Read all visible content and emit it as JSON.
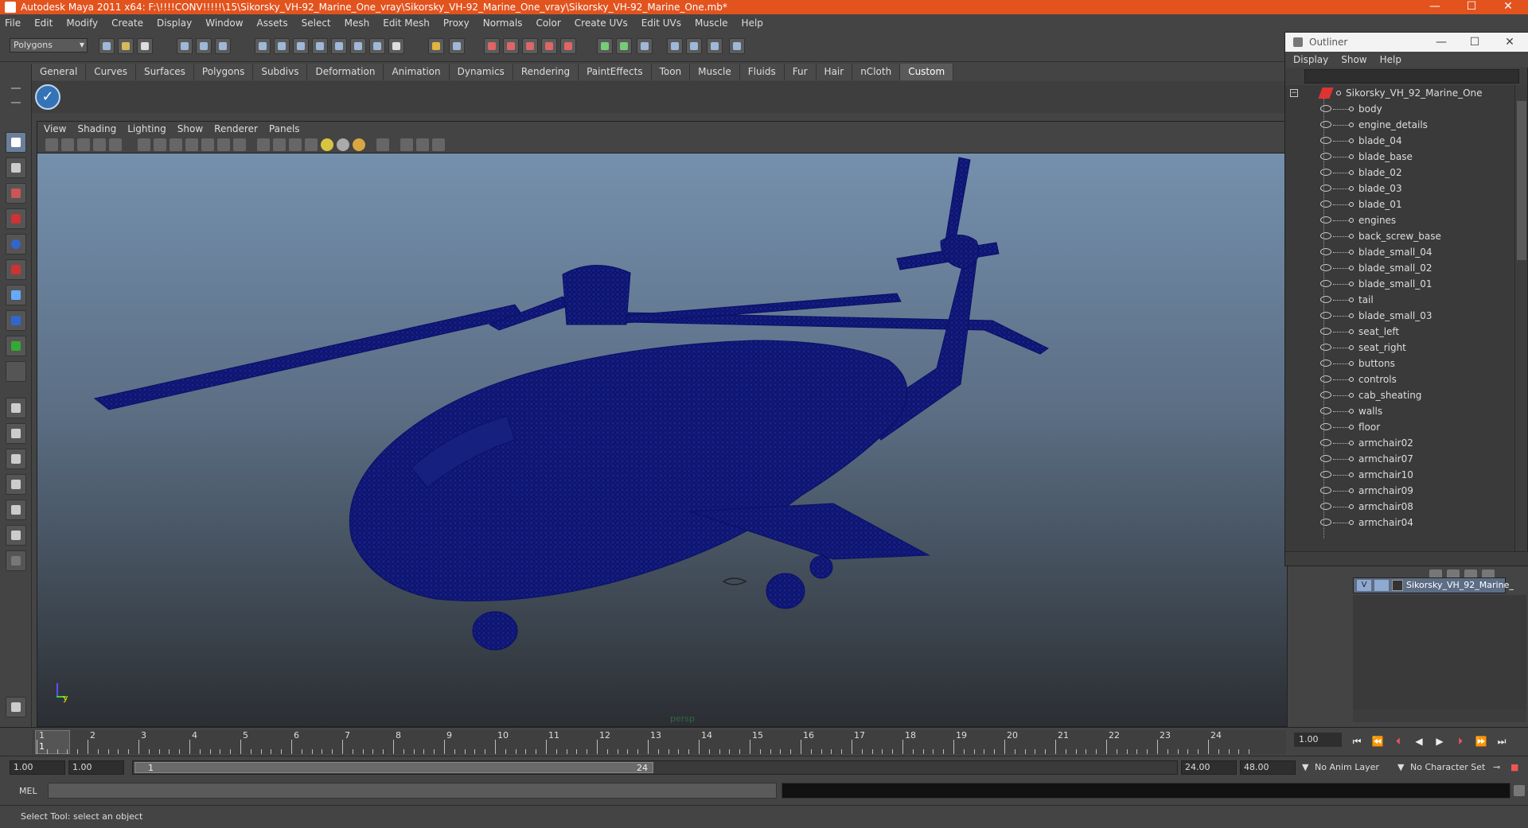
{
  "window": {
    "title": "Autodesk Maya 2011 x64: F:\\!!!!CONV!!!!!\\15\\Sikorsky_VH-92_Marine_One_vray\\Sikorsky_VH-92_Marine_One_vray\\Sikorsky_VH-92_Marine_One.mb*",
    "minimize": "—",
    "maximize": "☐",
    "close": "✕"
  },
  "menubar": [
    "File",
    "Edit",
    "Modify",
    "Create",
    "Display",
    "Window",
    "Assets",
    "Select",
    "Mesh",
    "Edit Mesh",
    "Proxy",
    "Normals",
    "Color",
    "Create UVs",
    "Edit UVs",
    "Muscle",
    "Help"
  ],
  "toolbar": {
    "mode": "Polygons"
  },
  "shelf": {
    "tabs": [
      "General",
      "Curves",
      "Surfaces",
      "Polygons",
      "Subdivs",
      "Deformation",
      "Animation",
      "Dynamics",
      "Rendering",
      "PaintEffects",
      "Toon",
      "Muscle",
      "Fluids",
      "Fur",
      "Hair",
      "nCloth",
      "Custom"
    ],
    "active_tab": "Custom"
  },
  "viewport": {
    "menu": [
      "View",
      "Shading",
      "Lighting",
      "Show",
      "Renderer",
      "Panels"
    ],
    "camera": "persp",
    "axis_y": "y",
    "model_color": "#0d1470"
  },
  "outliner": {
    "title": "Outliner",
    "menu": [
      "Display",
      "Show",
      "Help"
    ],
    "root": "Sikorsky_VH_92_Marine_One",
    "items": [
      "body",
      "engine_details",
      "blade_04",
      "blade_base",
      "blade_02",
      "blade_03",
      "blade_01",
      "engines",
      "back_screw_base",
      "blade_small_04",
      "blade_small_02",
      "blade_small_01",
      "tail",
      "blade_small_03",
      "seat_left",
      "seat_right",
      "buttons",
      "controls",
      "cab_sheating",
      "walls",
      "floor",
      "armchair02",
      "armchair07",
      "armchair10",
      "armchair09",
      "armchair08",
      "armchair04"
    ]
  },
  "layers": {
    "visible_flag": "V",
    "name": "Sikorsky_VH_92_Marine_"
  },
  "timeline": {
    "ticks": [
      "1",
      "2",
      "3",
      "4",
      "5",
      "6",
      "7",
      "8",
      "9",
      "10",
      "11",
      "12",
      "13",
      "14",
      "15",
      "16",
      "17",
      "18",
      "19",
      "20",
      "21",
      "22",
      "23",
      "24"
    ],
    "current_frame": "1",
    "current_field": "1.00"
  },
  "range": {
    "start": "1.00",
    "playback_start": "1.00",
    "slider_start": "1",
    "slider_end": "24",
    "playback_end": "24.00",
    "end": "48.00",
    "anim_layer": "No Anim Layer",
    "char_set": "No Character Set"
  },
  "command": {
    "label": "MEL"
  },
  "help_line": "Select Tool: select an object"
}
